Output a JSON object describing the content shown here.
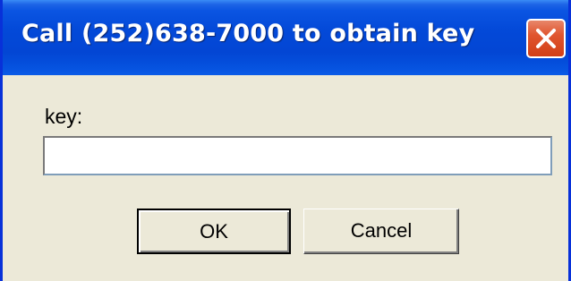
{
  "dialog": {
    "title": "Call (252)638-7000 to obtain key",
    "field_label": "key:",
    "field_value": "",
    "ok_label": "OK",
    "cancel_label": "Cancel",
    "close_icon": "close-icon"
  },
  "colors": {
    "titlebar": "#0349d8",
    "window_bg": "#ece9d8",
    "close_button": "#e0552f"
  }
}
